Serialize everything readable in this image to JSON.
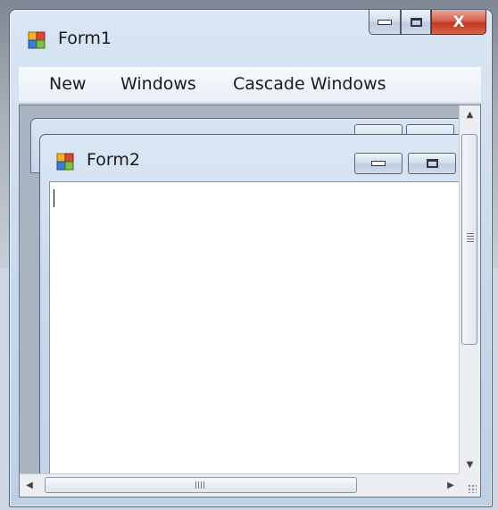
{
  "window": {
    "title": "Form1",
    "icon": "form-icon"
  },
  "menu": {
    "items": [
      "New",
      "Windows",
      "Cascade Windows"
    ]
  },
  "child_window": {
    "title": "Form2",
    "icon": "form-icon"
  },
  "textbox": {
    "value": ""
  },
  "scrollbars": {
    "horizontal_grip": "III"
  }
}
